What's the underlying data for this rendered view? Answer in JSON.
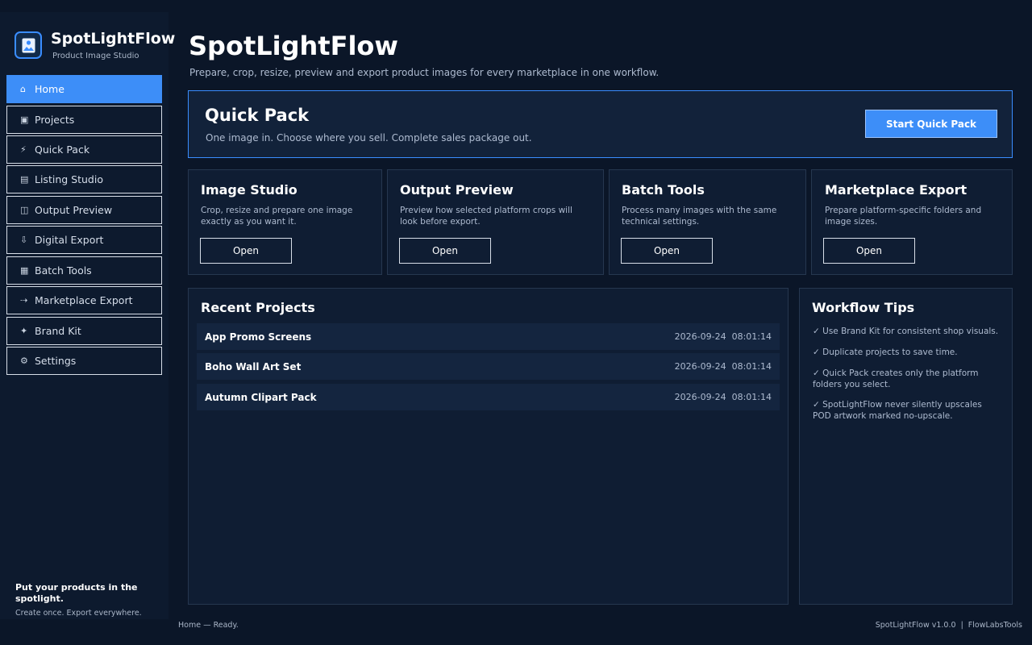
{
  "app": {
    "name": "SpotLightFlow",
    "tagline": "Product Image Studio"
  },
  "sidebar": {
    "items": [
      {
        "icon": "home-icon",
        "glyph": "⌂",
        "label": "Home",
        "active": true
      },
      {
        "icon": "projects-icon",
        "glyph": "▣",
        "label": "Projects"
      },
      {
        "icon": "lightning-icon",
        "glyph": "⚡",
        "label": "Quick Pack"
      },
      {
        "icon": "listing-icon",
        "glyph": "▤",
        "label": "Listing Studio"
      },
      {
        "icon": "preview-icon",
        "glyph": "◫",
        "label": "Output Preview"
      },
      {
        "icon": "download-icon",
        "glyph": "⇩",
        "label": "Digital Export"
      },
      {
        "icon": "batch-icon",
        "glyph": "▦",
        "label": "Batch Tools"
      },
      {
        "icon": "export-arrow-icon",
        "glyph": "⇢",
        "label": "Marketplace Export"
      },
      {
        "icon": "sparkle-icon",
        "glyph": "✦",
        "label": "Brand Kit"
      },
      {
        "icon": "gear-icon",
        "glyph": "⚙",
        "label": "Settings"
      }
    ],
    "footer_head": "Put your products in the spotlight.",
    "footer_sub": "Create once. Export everywhere."
  },
  "header": {
    "title": "SpotLightFlow",
    "subtitle": "Prepare, crop, resize, preview and export product images for every marketplace in one workflow."
  },
  "quick_pack": {
    "title": "Quick Pack",
    "subtitle": "One image in. Choose where you sell. Complete sales package out.",
    "button": "Start Quick Pack"
  },
  "cards": [
    {
      "title": "Image Studio",
      "desc": "Crop, resize and prepare one image exactly as you want it.",
      "button": "Open"
    },
    {
      "title": "Output Preview",
      "desc": "Preview how selected platform crops will look before export.",
      "button": "Open"
    },
    {
      "title": "Batch Tools",
      "desc": "Process many images with the same technical settings.",
      "button": "Open"
    },
    {
      "title": "Marketplace Export",
      "desc": "Prepare platform-specific folders and image sizes.",
      "button": "Open"
    }
  ],
  "recent": {
    "title": "Recent Projects",
    "rows": [
      {
        "name": "App Promo Screens",
        "time": "2026-09-24  08:01:14"
      },
      {
        "name": "Boho Wall Art Set",
        "time": "2026-09-24  08:01:14"
      },
      {
        "name": "Autumn Clipart Pack",
        "time": "2026-09-24  08:01:14"
      }
    ]
  },
  "tips": {
    "title": "Workflow Tips",
    "items": [
      "✓  Use Brand Kit for consistent shop visuals.",
      "✓  Duplicate projects to save time.",
      "✓  Quick Pack creates only the platform folders you select.",
      "✓  SpotLightFlow never silently upscales POD artwork marked no-upscale."
    ]
  },
  "status": {
    "left": "Home — Ready.",
    "right": "SpotLightFlow v1.0.0  |  FlowLabsTools"
  },
  "colors": {
    "background": "#0b1628",
    "accent": "#3d8ef8",
    "panel": "#0f1d33"
  }
}
